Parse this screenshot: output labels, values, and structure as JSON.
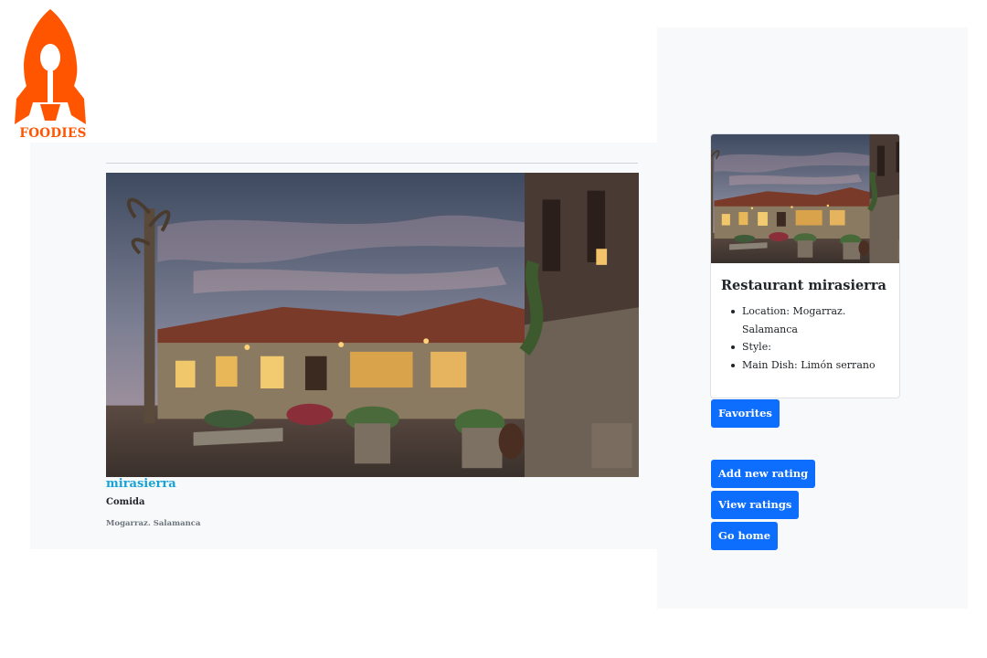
{
  "brand": {
    "name": "FOODIES",
    "color": "#ff5400",
    "logo_icon": "rocket-spoon-icon"
  },
  "listing": {
    "name": "mirasierra",
    "category": "Comida",
    "location": "Mogarraz. Salamanca",
    "photo": "restaurant-exterior-photo"
  },
  "detail_card": {
    "title": "Restaurant mirasierra",
    "items": [
      "Location: Mogarraz. Salamanca",
      "Style:",
      "Main Dish: Limón serrano"
    ]
  },
  "actions": {
    "favorites": "Favorites",
    "add_rating": "Add new rating",
    "view_ratings": "View ratings",
    "go_home": "Go home"
  },
  "colors": {
    "accent": "#0d6efd",
    "title_link": "#17a2d6",
    "panel_bg": "#f8f9fa"
  }
}
